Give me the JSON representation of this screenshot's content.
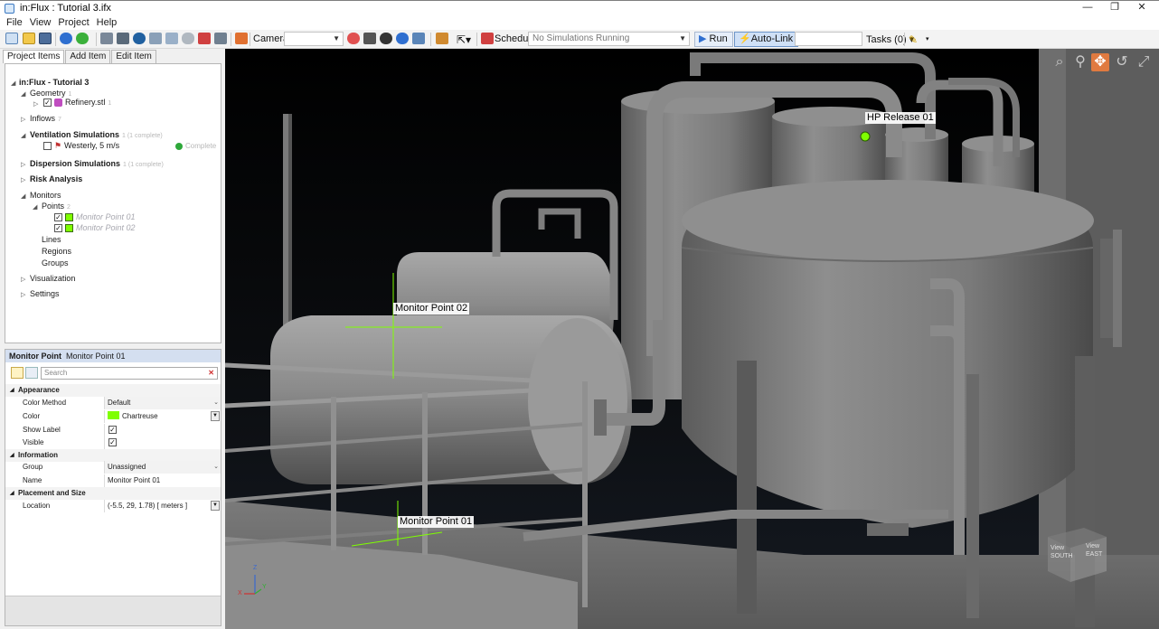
{
  "window": {
    "title": "in:Flux : Tutorial 3.ifx",
    "minimize": "—",
    "restore": "❐",
    "close": "✕"
  },
  "menu": [
    "File",
    "View",
    "Project",
    "Help"
  ],
  "toolbar": {
    "camera_label": "Camera:",
    "camera_value": "",
    "schedule_label": "Schedule:",
    "schedule_value": "No Simulations Running",
    "run_label": "Run",
    "autolink_label": "Auto-Link",
    "tasks_label": "Tasks (0)"
  },
  "tabs": [
    "Project Items",
    "Add Item",
    "Edit Item"
  ],
  "tree": {
    "root": "in:Flux - Tutorial 3",
    "geometry": {
      "label": "Geometry",
      "count": "1"
    },
    "refinery": {
      "label": "Refinery.stl",
      "count": "1"
    },
    "inflows": {
      "label": "Inflows",
      "count": "7"
    },
    "ventilation": {
      "label": "Ventilation Simulations",
      "count": "1 (1 complete)"
    },
    "westerly": {
      "label": "Westerly, 5 m/s",
      "status": "Complete"
    },
    "dispersion": {
      "label": "Dispersion Simulations",
      "count": "1 (1 complete)"
    },
    "risk": {
      "label": "Risk Analysis"
    },
    "monitors": {
      "label": "Monitors"
    },
    "points": {
      "label": "Points",
      "count": "2"
    },
    "mp1": {
      "label": "Monitor Point 01",
      "color": "#7fff00"
    },
    "mp2": {
      "label": "Monitor Point 02",
      "color": "#7fff00"
    },
    "lines": {
      "label": "Lines"
    },
    "regions": {
      "label": "Regions"
    },
    "groups": {
      "label": "Groups"
    },
    "visualization": {
      "label": "Visualization"
    },
    "settings": {
      "label": "Settings"
    }
  },
  "properties": {
    "type": "Monitor Point",
    "name": "Monitor Point 01",
    "search_placeholder": "Search",
    "appearance": "Appearance",
    "color_method_key": "Color Method",
    "color_method_val": "Default",
    "color_key": "Color",
    "color_val": "Chartreuse",
    "color_hex": "#7fff00",
    "show_label_key": "Show Label",
    "visible_key": "Visible",
    "information": "Information",
    "group_key": "Group",
    "group_val": "Unassigned",
    "name_key": "Name",
    "name_val": "Monitor Point 01",
    "placement": "Placement and Size",
    "location_key": "Location",
    "location_val": "(-5.5, 29, 1.78) [ meters ]"
  },
  "viewport": {
    "labels": {
      "hp_release": "HP Release 01",
      "mp2": "Monitor Point 02",
      "mp1": "Monitor Point 01"
    },
    "axis_z": "Z",
    "axis_x": "X",
    "axis_y": "Y",
    "cube_south": "View SOUTH",
    "cube_east": "View EAST",
    "marker_color": "#7fff00"
  }
}
